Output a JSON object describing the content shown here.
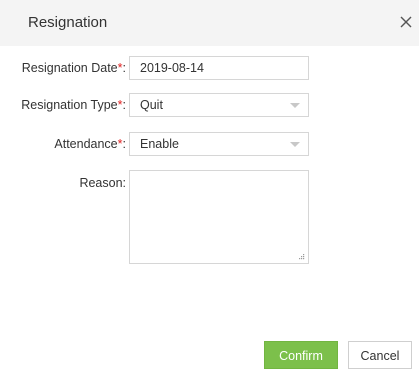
{
  "dialog": {
    "title": "Resignation"
  },
  "form": {
    "required_mark": "*",
    "resignation_date": {
      "label": "Resignation Date",
      "suffix": ":",
      "value": "2019-08-14"
    },
    "resignation_type": {
      "label": "Resignation Type",
      "suffix": ":",
      "value": "Quit"
    },
    "attendance": {
      "label": "Attendance",
      "suffix": ":",
      "value": "Enable"
    },
    "reason": {
      "label": "Reason:",
      "value": ""
    }
  },
  "buttons": {
    "confirm_label": "Confirm",
    "cancel_label": "Cancel"
  },
  "colors": {
    "confirm_bg": "#7cc04b",
    "required": "#e02020",
    "header_bg": "#f4f4f4"
  },
  "icons": {
    "close": "close-icon",
    "dropdown": "chevron-down-icon",
    "resize": "resize-grip-icon"
  }
}
